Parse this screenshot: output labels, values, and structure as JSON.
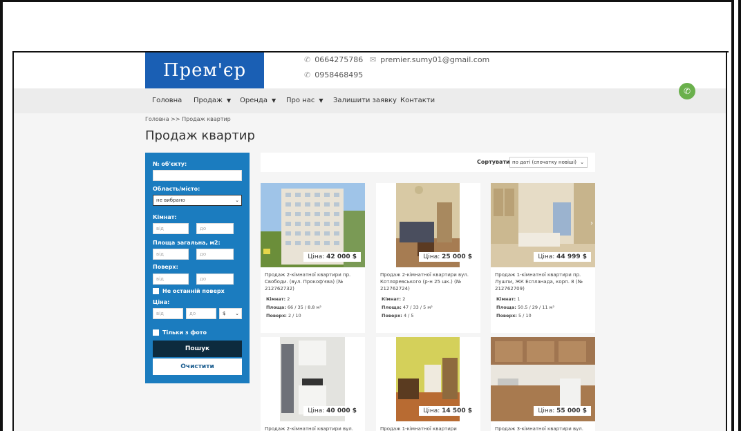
{
  "header": {
    "logo_text": "Прем'єр",
    "phone1": "0664275786",
    "phone2": "0958468495",
    "email": "premier.sumy01@gmail.com"
  },
  "nav": {
    "items": [
      "Головна",
      "Продаж",
      "Оренда",
      "Про нас",
      "Залишити заявку",
      "Контакти"
    ]
  },
  "breadcrumb": "Головна >> Продаж квартир",
  "page_title": "Продаж квартир",
  "filter": {
    "object_no_label": "№ об'єкту:",
    "region_label": "Область/місто:",
    "region_value": "не вибрано",
    "rooms_label": "Кімнат:",
    "area_label": "Площа загальна, м2:",
    "floor_label": "Поверх:",
    "not_last_floor": "Не останній поверх",
    "price_label": "Ціна:",
    "currency": "$",
    "from_placeholder": "від",
    "to_placeholder": "до",
    "only_photo": "Тільки з фото",
    "search_button": "Пошук",
    "clear_button": "Очистити"
  },
  "sort": {
    "label": "Сортувати",
    "value": "по даті (спочатку новіші)"
  },
  "listings": [
    {
      "price_prefix": "Ціна:",
      "price": "42 000 $",
      "title": "Продаж 2-кімнатної квартири пр. Свободи. (вул. Прокоф'єва) (№ 212762732)",
      "rooms_label": "Кімнат:",
      "rooms": "2",
      "area_label": "Площа:",
      "area": "66 / 35 / 8.8 м²",
      "floor_label": "Поверх:",
      "floor": "2 / 10"
    },
    {
      "price_prefix": "Ціна:",
      "price": "25 000 $",
      "title": "Продаж 2-кімнатної квартири вул. Котляревського (р-н 25 шк.) (№ 212762724)",
      "rooms_label": "Кімнат:",
      "rooms": "2",
      "area_label": "Площа:",
      "area": "47 / 33 / 5 м²",
      "floor_label": "Поверх:",
      "floor": "4 / 5"
    },
    {
      "price_prefix": "Ціна:",
      "price": "44 999 $",
      "title": "Продаж 1-кімнатної квартири пр. Лушпи, ЖК Еспланада, корп. 8 (№ 212762709)",
      "rooms_label": "Кімнат:",
      "rooms": "1",
      "area_label": "Площа:",
      "area": "50.5 / 29 / 11 м²",
      "floor_label": "Поверх:",
      "floor": "5 / 10"
    },
    {
      "price_prefix": "Ціна:",
      "price": "40 000 $",
      "title": "Продаж 2-кімнатної квартири вул."
    },
    {
      "price_prefix": "Ціна:",
      "price": "14 500 $",
      "title": "Продаж 1-кімнатної квартири"
    },
    {
      "price_prefix": "Ціна:",
      "price": "55 000 $",
      "title": "Продаж 3-кімнатної квартири вул."
    }
  ],
  "colors": {
    "brand_blue": "#1a5fb4",
    "filter_blue": "#1b7cbf",
    "search_btn": "#0d2b3e",
    "call_green": "#6ab04c"
  }
}
